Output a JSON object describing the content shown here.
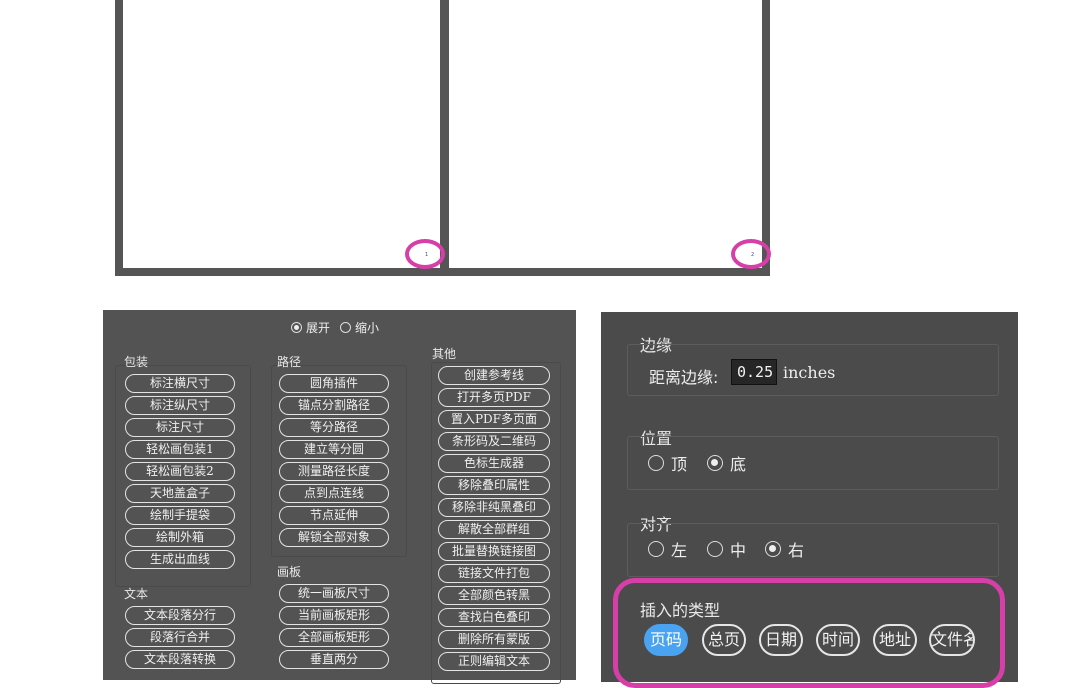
{
  "artboards": [
    {
      "page_number": "1"
    },
    {
      "page_number": "2"
    }
  ],
  "colors": {
    "highlight": "#d63fa8",
    "accent": "#4aa3f0",
    "panel": "#535353"
  },
  "left_panel": {
    "toggle": {
      "expand": "展开",
      "collapse": "缩小",
      "selected": "展开"
    },
    "groups": {
      "packaging": {
        "label": "包装",
        "buttons": [
          "标注横尺寸",
          "标注纵尺寸",
          "标注尺寸",
          "轻松画包装1",
          "轻松画包装2",
          "天地盖盒子",
          "绘制手提袋",
          "绘制外箱",
          "生成出血线"
        ]
      },
      "text": {
        "label": "文本",
        "buttons": [
          "文本段落分行",
          "段落行合并",
          "文本段落转换"
        ]
      },
      "path": {
        "label": "路径",
        "buttons": [
          "圆角插件",
          "锚点分割路径",
          "等分路径",
          "建立等分圆",
          "测量路径长度",
          "点到点连线",
          "节点延伸",
          "解锁全部对象"
        ]
      },
      "artboard": {
        "label": "画板",
        "buttons": [
          "统一画板尺寸",
          "当前画板矩形",
          "全部画板矩形",
          "垂直两分"
        ]
      },
      "other": {
        "label": "其他",
        "buttons": [
          "创建参考线",
          "打开多页PDF",
          "置入PDF多页面",
          "条形码及二维码",
          "色标生成器",
          "移除叠印属性",
          "移除非纯黑叠印",
          "解散全部群组",
          "批量替换链接图",
          "链接文件打包",
          "全部颜色转黑",
          "查找白色叠印",
          "删除所有蒙版",
          "正则编辑文本"
        ]
      }
    }
  },
  "right_panel": {
    "margin": {
      "title": "边缘",
      "label": "距离边缘:",
      "value": "0.25",
      "unit": "inches"
    },
    "position": {
      "title": "位置",
      "options": [
        "顶",
        "底"
      ],
      "selected": "底"
    },
    "align": {
      "title": "对齐",
      "options": [
        "左",
        "中",
        "右"
      ],
      "selected": "右"
    },
    "insert_type": {
      "title": "插入的类型",
      "options": [
        "页码",
        "总页",
        "日期",
        "时间",
        "地址",
        "文件名"
      ],
      "selected": "页码"
    }
  }
}
